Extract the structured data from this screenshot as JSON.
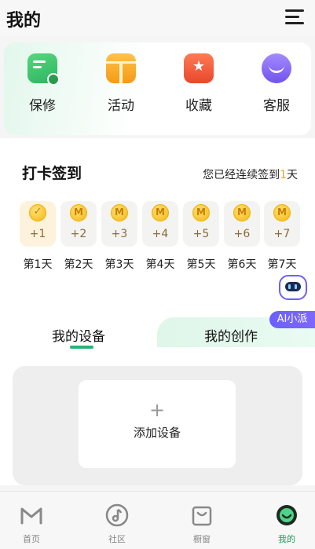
{
  "header": {
    "title": "我的"
  },
  "quick_actions": [
    {
      "label": "保修",
      "icon": "wrench-card-icon",
      "color": "#3ec46d"
    },
    {
      "label": "活动",
      "icon": "gift-icon",
      "color": "#f6a623"
    },
    {
      "label": "收藏",
      "icon": "star-box-icon",
      "color": "#ef5a3a"
    },
    {
      "label": "客服",
      "icon": "headset-icon",
      "color": "#8b6cf6"
    }
  ],
  "checkin": {
    "title": "打卡签到",
    "status_prefix": "您已经连续签到",
    "status_days": "1",
    "status_suffix": "天",
    "days": [
      {
        "amount": "+1",
        "label": "第1天",
        "done": true
      },
      {
        "amount": "+2",
        "label": "第2天",
        "done": false
      },
      {
        "amount": "+3",
        "label": "第3天",
        "done": false
      },
      {
        "amount": "+4",
        "label": "第4天",
        "done": false
      },
      {
        "amount": "+5",
        "label": "第5天",
        "done": false
      },
      {
        "amount": "+6",
        "label": "第6天",
        "done": false
      },
      {
        "amount": "+7",
        "label": "第7天",
        "done": false
      }
    ],
    "coin_mark": "M"
  },
  "ai_assistant": {
    "label": "AI小派"
  },
  "tabs": [
    {
      "label": "我的设备",
      "active": true
    },
    {
      "label": "我的创作",
      "active": false
    }
  ],
  "devices": {
    "add_label": "添加设备",
    "add_symbol": "+"
  },
  "bottom_nav": [
    {
      "label": "首页",
      "icon": "home-m-icon",
      "active": false
    },
    {
      "label": "社区",
      "icon": "music-note-icon",
      "active": false
    },
    {
      "label": "橱窗",
      "icon": "shopping-bag-icon",
      "active": false
    },
    {
      "label": "我的",
      "icon": "profile-smile-icon",
      "active": true
    }
  ],
  "colors": {
    "accent": "#2bb37a",
    "coin": "#f5b50f",
    "ai": "#6a60ff"
  }
}
